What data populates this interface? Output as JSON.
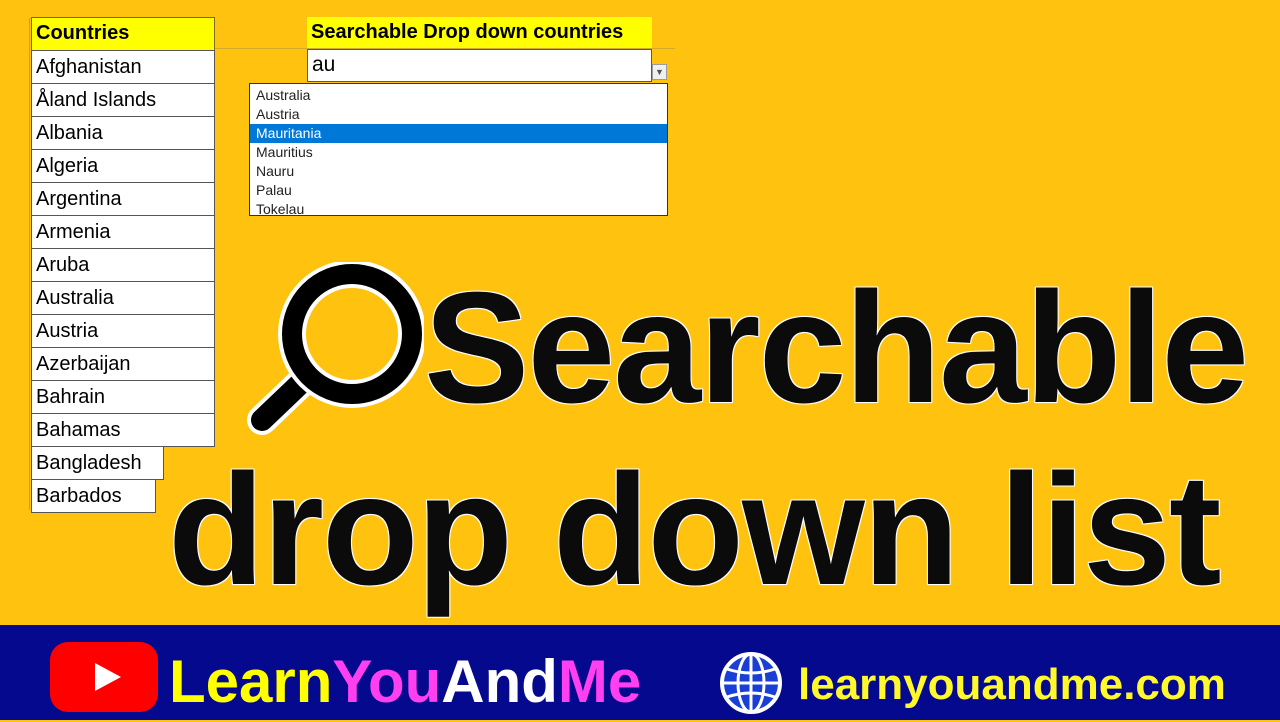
{
  "sheet": {
    "countries_header": "Countries",
    "search_header": "Searchable Drop down countries",
    "countries": [
      "Afghanistan",
      "Åland Islands",
      "Albania",
      "Algeria",
      "Argentina",
      "Armenia",
      "Aruba",
      "Australia",
      "Austria",
      "Azerbaijan",
      "Bahrain",
      "Bahamas",
      "Bangladesh",
      "Barbados"
    ],
    "search_value": "au",
    "dropdown_options": [
      "Australia",
      "Austria",
      "Mauritania",
      "Mauritius",
      "Nauru",
      "Palau",
      "Tokelau"
    ],
    "selected_option": "Mauritania"
  },
  "headline": {
    "line1": "Searchable",
    "line2": "drop down list"
  },
  "footer": {
    "brand_part1": "Learn",
    "brand_part2": "You",
    "brand_part3": "And",
    "brand_part4": "Me",
    "url": "learnyouandme.com"
  },
  "colors": {
    "background": "#FFC20E",
    "header_fill": "#FFFF00",
    "footer": "#04098D",
    "selection": "#0078D7",
    "youtube_red": "#FF0000",
    "brand_pink": "#FF3FF0"
  },
  "icons": [
    "magnifier-icon",
    "youtube-icon",
    "globe-icon",
    "dropdown-arrow-icon"
  ]
}
